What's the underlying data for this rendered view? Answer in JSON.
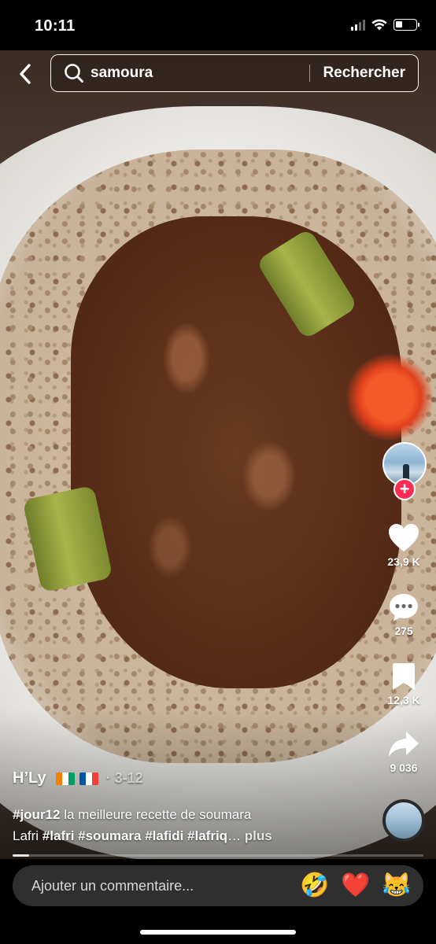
{
  "status_bar": {
    "time": "10:11"
  },
  "search": {
    "query": "samoura",
    "submit_label": "Rechercher"
  },
  "actions": {
    "like_count": "23,9 K",
    "comment_count": "275",
    "save_count": "12,3 K",
    "share_count": "9 036",
    "follow_label": "+"
  },
  "post": {
    "author": "H’Ly",
    "date": "· 3-12",
    "line1": {
      "hashtag": "#jour12",
      "text": " la meilleure recette de soumara"
    },
    "line2": {
      "text": "Lafri ",
      "hashtags": "#lafri #soumara #lafidi #lafriq",
      "ellipsis": "…",
      "more_label": " plus"
    }
  },
  "progress": {
    "played_fraction": 0.04
  },
  "comment_bar": {
    "placeholder": "Ajouter un commentaire...",
    "emoji_1": "🤣",
    "emoji_2": "❤️",
    "emoji_3": "😹"
  },
  "colors": {
    "follow_accent": "#fe2c55",
    "comment_bar_bg": "#2f2f2f"
  },
  "icons": [
    "back-arrow-icon",
    "search-icon",
    "heart-icon",
    "comment-icon",
    "bookmark-icon",
    "share-icon",
    "flag-ci-icon",
    "flag-fr-icon"
  ]
}
